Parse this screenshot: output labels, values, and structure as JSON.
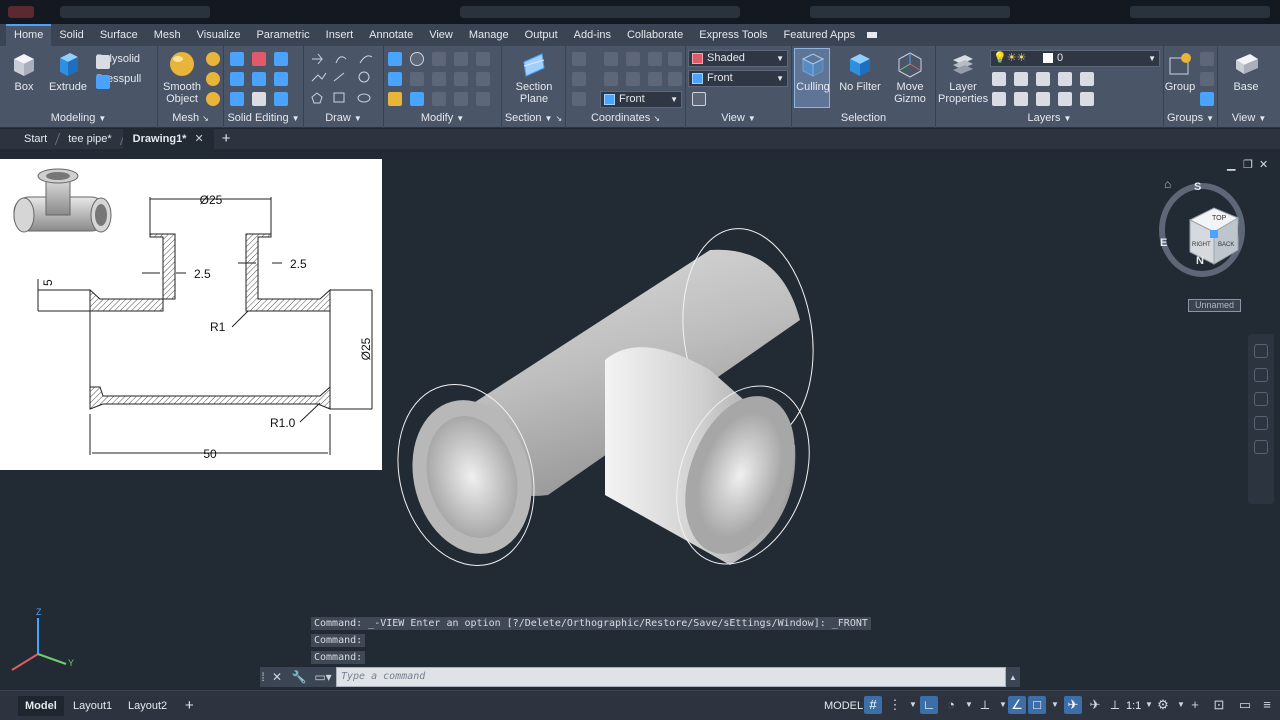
{
  "ribbon_tabs": [
    "Home",
    "Solid",
    "Surface",
    "Mesh",
    "Visualize",
    "Parametric",
    "Insert",
    "Annotate",
    "View",
    "Manage",
    "Output",
    "Add-ins",
    "Collaborate",
    "Express Tools",
    "Featured Apps"
  ],
  "modeling": {
    "box": "Box",
    "extrude": "Extrude",
    "polysolid": "Polysolid",
    "presspull": "Presspull",
    "title": "Modeling"
  },
  "mesh": {
    "smooth_object_1": "Smooth",
    "smooth_object_2": "Object",
    "title": "Mesh"
  },
  "solid_editing": {
    "title": "Solid Editing"
  },
  "draw": {
    "title": "Draw"
  },
  "modify": {
    "title": "Modify"
  },
  "section": {
    "plane_1": "Section",
    "plane_2": "Plane",
    "title": "Section"
  },
  "coordinates": {
    "ucs_combo": "Front",
    "title": "Coordinates"
  },
  "view": {
    "visual_style": "Shaded",
    "view_combo": "Front",
    "title": "View"
  },
  "selection": {
    "culling": "Culling",
    "no_filter": "No Filter",
    "move_gizmo_1": "Move",
    "move_gizmo_2": "Gizmo",
    "title": "Selection"
  },
  "layers": {
    "layer_properties_1": "Layer",
    "layer_properties_2": "Properties",
    "current_layer": "0",
    "title": "Layers"
  },
  "groups": {
    "group": "Group",
    "title": "Groups"
  },
  "view_panel": {
    "base": "Base",
    "title": "View"
  },
  "file_tabs": {
    "start": "Start",
    "tee_pipe": "tee pipe*",
    "drawing1": "Drawing1*"
  },
  "reference": {
    "top_dia": "Ø25",
    "wall_left": "2.5",
    "wall_right": "2.5",
    "flange": "5",
    "fillet_top": "R1",
    "right_dia": "Ø25",
    "fillet_bottom": "R1.0",
    "length": "50"
  },
  "viewcube": {
    "top": "TOP",
    "right": "RIGHT",
    "back": "BACK",
    "compass_s": "S",
    "compass_e": "E",
    "compass_n": "N",
    "ucs_label": "Unnamed"
  },
  "command": {
    "history_1": "Command: _-VIEW Enter an option [?/Delete/Orthographic/Restore/Save/sEttings/Window]: _FRONT",
    "history_2": "Command:",
    "history_3": "Command:",
    "placeholder": "Type a command"
  },
  "status": {
    "model_tab": "Model",
    "layout1": "Layout1",
    "layout2": "Layout2",
    "space": "MODEL",
    "scale": "1:1"
  },
  "colors": {
    "accent": "#4aa3ff",
    "ribbon": "#4a5568",
    "viewport": "#222a34"
  }
}
